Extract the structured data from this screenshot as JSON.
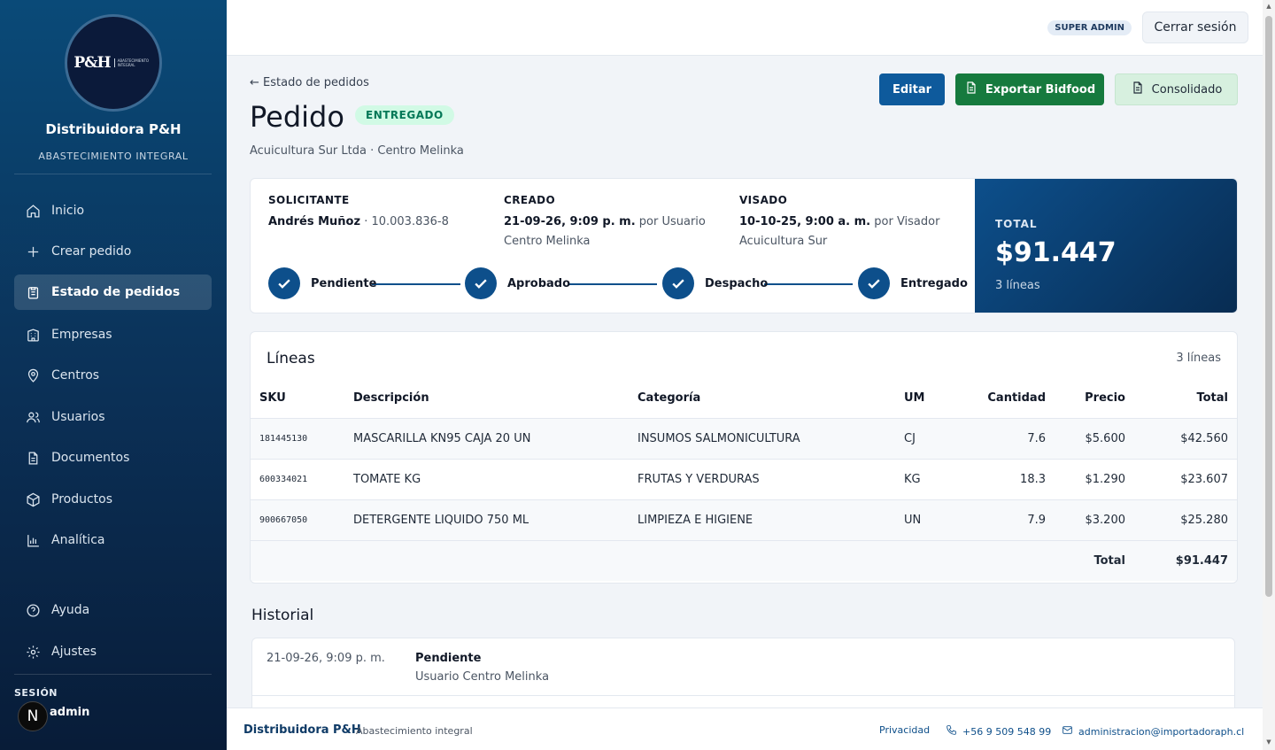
{
  "sidebar": {
    "logo": {
      "mark": "P&H",
      "subline": "ABASTECIMIENTO INTEGRAL"
    },
    "brand_name": "Distribuidora P&H",
    "brand_tagline": "ABASTECIMIENTO INTEGRAL",
    "nav": [
      {
        "label": "Inicio",
        "icon": "home-icon"
      },
      {
        "label": "Crear pedido",
        "icon": "plus-icon"
      },
      {
        "label": "Estado de pedidos",
        "icon": "clipboard-icon",
        "active": true
      },
      {
        "label": "Empresas",
        "icon": "building-icon"
      },
      {
        "label": "Centros",
        "icon": "map-pin-icon"
      },
      {
        "label": "Usuarios",
        "icon": "users-icon"
      },
      {
        "label": "Documentos",
        "icon": "document-icon"
      },
      {
        "label": "Productos",
        "icon": "box-icon"
      },
      {
        "label": "Analítica",
        "icon": "bar-chart-icon"
      }
    ],
    "secondary_nav": [
      {
        "label": "Ayuda",
        "icon": "help-circle-icon"
      },
      {
        "label": "Ajustes",
        "icon": "gear-icon"
      }
    ],
    "session_label": "SESIÓN",
    "session_user": "admin",
    "avatar_letter": "N"
  },
  "topbar": {
    "role_badge": "SUPER ADMIN",
    "logout_label": "Cerrar sesión"
  },
  "header": {
    "back_link": "← Estado de pedidos",
    "title": "Pedido",
    "status": "ENTREGADO",
    "subtitle": "Acuicultura Sur Ltda · Centro Melinka",
    "buttons": {
      "edit": "Editar",
      "export": "Exportar Bidfood",
      "consolidated": "Consolidado"
    }
  },
  "info": {
    "requester": {
      "label": "SOLICITANTE",
      "name": "Andrés Muñoz",
      "rut": " · 10.003.836-8"
    },
    "created": {
      "label": "CREADO",
      "date": "21-09-26, 9:09 p. m.",
      "by": " por Usuario Centro Melinka"
    },
    "approved": {
      "label": "VISADO",
      "date": "10-10-25, 9:00 a. m.",
      "by": " por Visador Acuicultura Sur"
    },
    "steps": [
      "Pendiente",
      "Aprobado",
      "Despacho",
      "Entregado"
    ],
    "total_label": "TOTAL",
    "total_amount": "$91.447",
    "total_lines": "3 líneas"
  },
  "lines": {
    "title": "Líneas",
    "count": "3 líneas",
    "columns": [
      "SKU",
      "Descripción",
      "Categoría",
      "UM",
      "Cantidad",
      "Precio",
      "Total"
    ],
    "rows": [
      {
        "sku": "181445130",
        "desc": "MASCARILLA KN95 CAJA 20 UN",
        "cat": "INSUMOS SALMONICULTURA",
        "um": "CJ",
        "qty": "7.6",
        "price": "$5.600",
        "total": "$42.560"
      },
      {
        "sku": "600334021",
        "desc": "TOMATE KG",
        "cat": "FRUTAS Y VERDURAS",
        "um": "KG",
        "qty": "18.3",
        "price": "$1.290",
        "total": "$23.607"
      },
      {
        "sku": "900667050",
        "desc": "DETERGENTE LIQUIDO 750 ML",
        "cat": "LIMPIEZA E HIGIENE",
        "um": "UN",
        "qty": "7.9",
        "price": "$3.200",
        "total": "$25.280"
      }
    ],
    "footer_label": "Total",
    "footer_total": "$91.447"
  },
  "history": {
    "title": "Historial",
    "entries": [
      {
        "date": "21-09-26, 9:09 p. m.",
        "status": "Pendiente",
        "user": "Usuario Centro Melinka"
      }
    ]
  },
  "footer": {
    "brand": "Distribuidora P&H",
    "tagline": "Abastecimiento integral",
    "privacy": "Privacidad",
    "phone": "+56 9 509 548 99",
    "email": "administracion@importadoraph.cl"
  },
  "colors": {
    "primary": "#0e5a9c",
    "success": "#167a3e",
    "status_bg": "#d1fae5",
    "status_text": "#047857",
    "sidebar_top": "#0a4a78",
    "sidebar_bottom": "#081c38"
  }
}
